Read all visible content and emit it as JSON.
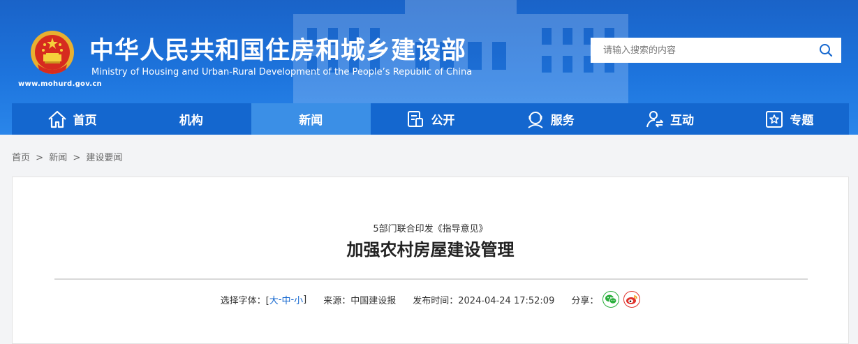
{
  "header": {
    "title_cn": "中华人民共和国住房和城乡建设部",
    "title_en": "Ministry of Housing and Urban-Rural Development of the People’s Republic of China",
    "site_url": "www.mohurd.gov.cn",
    "search_placeholder": "请输入搜索的内容"
  },
  "nav": {
    "items": [
      {
        "label": "首页",
        "icon": "home-icon"
      },
      {
        "label": "机构",
        "icon": ""
      },
      {
        "label": "新闻",
        "icon": "",
        "active": true
      },
      {
        "label": "公开",
        "icon": "document-icon"
      },
      {
        "label": "服务",
        "icon": "service-icon"
      },
      {
        "label": "互动",
        "icon": "interaction-icon"
      },
      {
        "label": "专题",
        "icon": "star-icon"
      }
    ]
  },
  "breadcrumb": {
    "items": [
      "首页",
      "新闻",
      "建设要闻"
    ],
    "separator": ">"
  },
  "article": {
    "subtitle": "5部门联合印发《指导意见》",
    "title": "加强农村房屋建设管理",
    "font_label": "选择字体：[",
    "font_large": "大",
    "font_medium": "中",
    "font_small": "小",
    "font_sep": "-",
    "font_end": "]",
    "source": "来源：中国建设报",
    "publish_time": "发布时间：2024-04-24 17:52:09",
    "share_label": "分享："
  },
  "colors": {
    "brand_blue": "#1467cf",
    "nav_active": "#3b8fe6",
    "wechat_green": "#2aae3c",
    "weibo_red": "#e0312b"
  }
}
